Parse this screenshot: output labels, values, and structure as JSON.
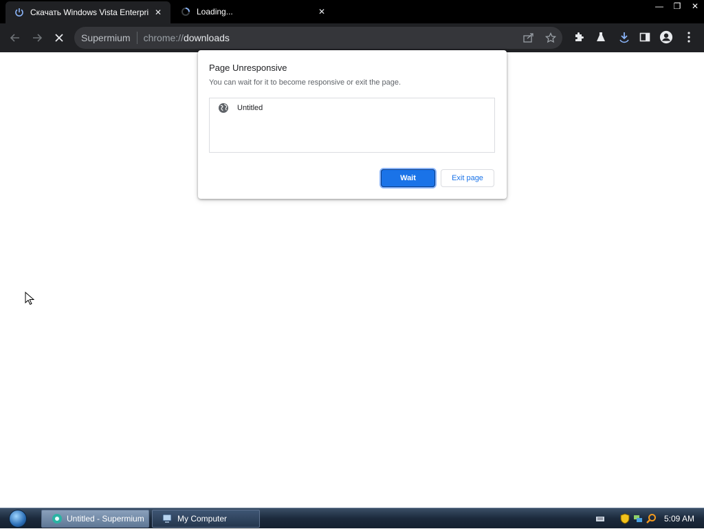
{
  "tabs": [
    {
      "title": "Скачать Windows Vista Enterpris",
      "icon": "power-icon",
      "close": "✕"
    },
    {
      "title": "Loading...",
      "icon": "loading-spinner-icon",
      "close": "✕"
    }
  ],
  "window_controls": {
    "minimize": "—",
    "restore": "❐",
    "close": "✕"
  },
  "toolbar": {
    "site_label": "Supermium",
    "url_prefix": "chrome://",
    "url_host": "downloads"
  },
  "dialog": {
    "title": "Page Unresponsive",
    "subtitle": "You can wait for it to become responsive or exit the page.",
    "pages": [
      {
        "title": "Untitled",
        "icon": "globe-icon"
      }
    ],
    "wait_label": "Wait",
    "exit_label": "Exit page"
  },
  "taskbar": {
    "items": [
      {
        "label": "Untitled - Supermium",
        "icon": "supermium-icon",
        "active": true
      },
      {
        "label": "My Computer",
        "icon": "computer-icon",
        "active": false
      }
    ],
    "clock": "5:09 AM"
  },
  "colors": {
    "accent": "#1a73e8",
    "chrome_bg": "#202124",
    "tabstrip_bg": "#000000",
    "omnibox_bg": "#35363a"
  }
}
